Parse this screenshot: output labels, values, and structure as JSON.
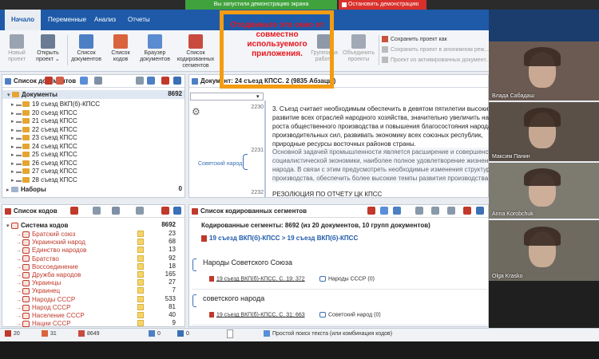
{
  "share": {
    "message": "Вы запустили демонстрацию экрана",
    "stop_label": "Остановить демонстрацию"
  },
  "menu": {
    "tabs": [
      "Начало",
      "Переменные",
      "Анализ",
      "Отчеты"
    ]
  },
  "ribbon": {
    "buttons": [
      {
        "label": "Новый проект",
        "lines": [
          "Новый",
          "проект"
        ],
        "color": "#9aa4b0",
        "disabled": true
      },
      {
        "label": "Открыть проект",
        "lines": [
          "Открыть",
          "проект ⌄"
        ],
        "color": "#6a7c93",
        "disabled": false
      },
      {
        "label": "Список документов",
        "lines": [
          "Список",
          "документов"
        ],
        "color": "#4d7fc4",
        "disabled": false
      },
      {
        "label": "Список кодов",
        "lines": [
          "Список",
          "кодов"
        ],
        "color": "#d9633d",
        "disabled": false
      },
      {
        "label": "Браузер документов",
        "lines": [
          "Браузер",
          "документов"
        ],
        "color": "#5b8bd1",
        "disabled": false
      },
      {
        "label": "Список кодированных сегментов",
        "lines": [
          "Список кодированных",
          "сегментов"
        ],
        "color": "#c84b3e",
        "disabled": false
      },
      {
        "label": "Групповая работа",
        "lines": [
          "Групповая",
          "работа"
        ],
        "color": "#8e99a8",
        "disabled": true
      },
      {
        "label": "Объединить проекты",
        "lines": [
          "Объединить",
          "проекты"
        ],
        "color": "#a0a9b5",
        "disabled": true
      }
    ],
    "right_items": [
      {
        "label": "Сохранить проект как",
        "disabled": false
      },
      {
        "label": "Сохранить проект в анонимном реж...",
        "disabled": true
      },
      {
        "label": "Проект из активированных документ...",
        "disabled": true
      }
    ]
  },
  "overlay": {
    "text": "Отодвиньте это окно от совместно используемого приложения."
  },
  "doc_panel": {
    "title": "Список документов",
    "root": {
      "label": "Документы",
      "count": "8692"
    },
    "items": [
      "19 съезд ВКП(б)-КПСС",
      "20 съезд КПСС",
      "21 съезд КПСС",
      "22 съезд КПСС",
      "23 съезд КПСС",
      "24 съезд КПСС",
      "25 съезд КПСС",
      "26 съезд КПСС",
      "27 съезд КПСС",
      "28 съезд КПСС"
    ],
    "sets": {
      "label": "Наборы",
      "count": "0"
    }
  },
  "code_panel": {
    "title": "Список кодов",
    "root": {
      "label": "Система кодов",
      "count": "8692"
    },
    "items": [
      {
        "label": "Братский союз",
        "count": "23"
      },
      {
        "label": "Украинский народ",
        "count": "68"
      },
      {
        "label": "Единство народов",
        "count": "13"
      },
      {
        "label": "Братство",
        "count": "92"
      },
      {
        "label": "Воссоединение",
        "count": "18"
      },
      {
        "label": "Дружба народов",
        "count": "165"
      },
      {
        "label": "Украинцы",
        "count": "27"
      },
      {
        "label": "Украинец",
        "count": "7"
      },
      {
        "label": "Народы СССР",
        "count": "533"
      },
      {
        "label": "Народ СССР",
        "count": "81"
      },
      {
        "label": "Население СССР",
        "count": "40"
      },
      {
        "label": "Нации СССР",
        "count": "9"
      }
    ]
  },
  "browser": {
    "title": "Документ: 24 съезд КПСС. 2   (9835 Абзацы)",
    "code_label": "Советский народ",
    "paragraphs": [
      {
        "num": "2230",
        "lines": [
          "3. Съезд считает необходимым обеспечить в девятом пятилетии высоких",
          "развитие всех отраслей народного хозяйства, значительно увеличить на",
          "роста общественного производства и повышения благосостояния народа",
          "производительных сил, развивать экономику всех союзных республик,",
          "природные ресурсы восточных районов страны."
        ]
      },
      {
        "num": "2231",
        "lines": [
          "Основной задачей промышленности является расширение и совершенство",
          "социалистической экономики, наиболее полное удовлетворение жизнен",
          "народа. В связи с этим предусмотреть необходимые изменения структуры",
          "производства, обеспечить более высокие темпы  развития   производства"
        ]
      },
      {
        "num": "2232",
        "lines": [
          "РЕЗОЛЮЦИЯ  ПО  ОТЧЕТУ  ЦК  КПСС"
        ]
      }
    ]
  },
  "segments": {
    "title": "Список кодированных сегментов",
    "summary": "Кодированные сегменты: 8692 (из 20 документов, 10 групп документов)",
    "path": "19 съезд ВКП(б)-КПСС > 19 съезд ВКП(б)-КПСС",
    "entries": [
      {
        "text": "Народы Советского Союза",
        "source": "19 съезд ВКП(б)-КПСС, С. 19: 372",
        "code": "Народы СССР (0)"
      },
      {
        "text": "советского народа",
        "source": "19 съезд ВКП(б)-КПСС, С. 31: 663",
        "code": "Советский народ (0)"
      }
    ]
  },
  "video": {
    "participants": [
      {
        "name": "Влада Сабадаш",
        "bg": "#6b5a52"
      },
      {
        "name": "Максим Панин",
        "bg": "#5a5048"
      },
      {
        "name": "Anna Korobchuk",
        "bg": "#7d7a70"
      },
      {
        "name": "Olga Krasko",
        "bg": "#6f6a60"
      }
    ]
  },
  "status": {
    "docs": "20",
    "codes": "31",
    "segments": "8649",
    "x1": "0",
    "x2": "0",
    "search_placeholder": "Простой поиск текста (или комбинация кодов)"
  }
}
